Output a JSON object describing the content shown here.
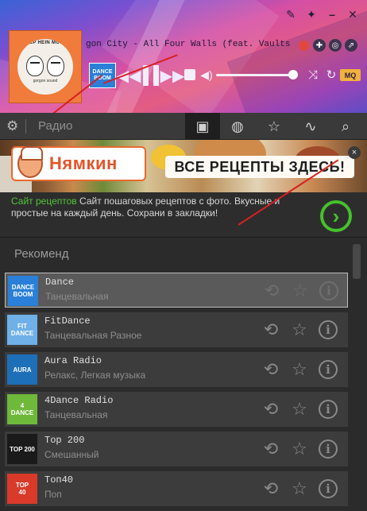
{
  "player": {
    "cover_title": "DEEP HEIN MUSIC",
    "cover_subtitle": "gorgon sound",
    "track_title": "gon City - All Four Walls (feat. Vaults & R",
    "station_thumb_line1": "DANCE",
    "station_thumb_line2": "BOOM",
    "quality_badge": "MQ",
    "icons": [
      "wrench-icon",
      "pin-icon",
      "minimize-icon",
      "close-icon",
      "record-icon",
      "gamepad-icon",
      "chrome-icon",
      "share-icon",
      "prev-icon",
      "pause-icon",
      "next-icon",
      "stop-icon",
      "volume-icon",
      "shuffle-icon",
      "repeat-icon"
    ],
    "volume_fraction": 0.95
  },
  "nav": {
    "label": "Радио",
    "tabs": [
      "radio-tab",
      "disc-tab",
      "favorites-tab",
      "equalizer-tab"
    ],
    "active_tab": "radio-tab"
  },
  "ad": {
    "brand": "Нямкин",
    "slogan": "ВСЕ РЕЦЕПТЫ ЗДЕСЬ!",
    "close_label": "×",
    "go_label": "›",
    "text_link": "Сайт рецептов",
    "text_body": " Сайт пошаговых рецептов с фото. Вкусные и простые на каждый день. Сохрани в закладки!"
  },
  "list": {
    "section_title": "Рекоменд",
    "stations": [
      {
        "name": "Dance",
        "genre": "Танцевальная",
        "thumb_line1": "DANCE",
        "thumb_line2": "BOOM",
        "thumb_color": "#2a7fd8",
        "selected": true
      },
      {
        "name": "FitDance",
        "genre": "Танцевальная Разное",
        "thumb_line1": "FIT",
        "thumb_line2": "DANCE",
        "thumb_color": "#6fb0e8",
        "selected": false
      },
      {
        "name": "Aura Radio",
        "genre": "Релакс, Легкая музыка",
        "thumb_line1": "AURA",
        "thumb_line2": "",
        "thumb_color": "#1d6fb8",
        "selected": false
      },
      {
        "name": "4Dance Radio",
        "genre": "Танцевальная",
        "thumb_line1": "4",
        "thumb_line2": "DANCE",
        "thumb_color": "#6eb83a",
        "selected": false
      },
      {
        "name": "Top 200",
        "genre": "Смешанный",
        "thumb_line1": "TOP 200",
        "thumb_line2": "",
        "thumb_color": "#1a1a1a",
        "selected": false
      },
      {
        "name": "Топ40",
        "genre": "Поп",
        "thumb_line1": "TOP",
        "thumb_line2": "40",
        "thumb_color": "#d93a2a",
        "selected": false
      }
    ]
  },
  "colors": {
    "accent_green": "#45c22c",
    "mq_badge": "#f0b13e",
    "record": "#e2473f"
  }
}
